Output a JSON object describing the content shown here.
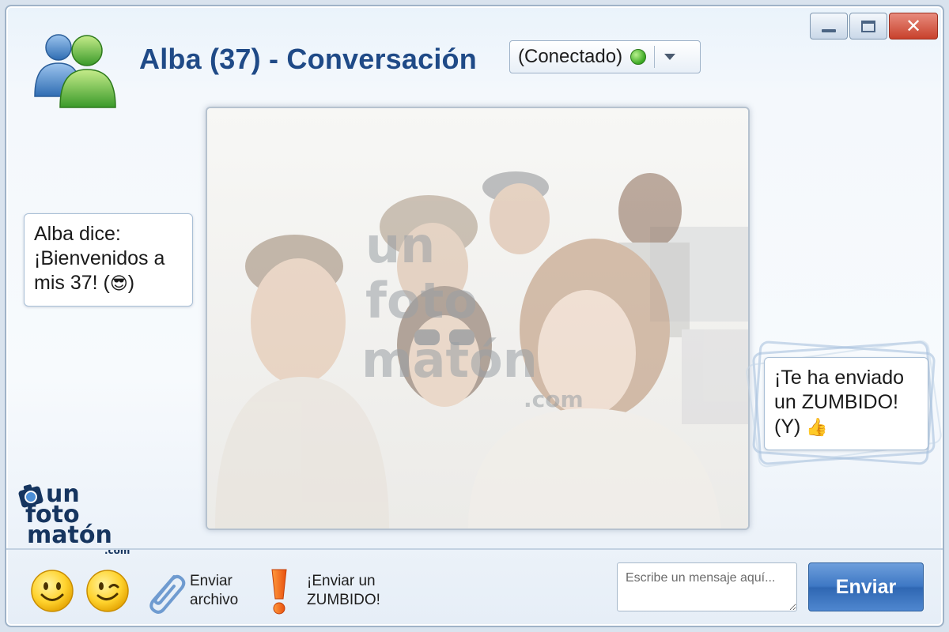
{
  "window": {
    "title": "Alba (37) - Conversación",
    "controls": {
      "minimize_icon": "minimize-icon",
      "maximize_icon": "maximize-icon",
      "close_icon": "close-icon",
      "close_glyph": "✕"
    }
  },
  "status": {
    "label": "(Conectado)",
    "color": "#3aa822"
  },
  "photo": {
    "watermark_lines": [
      "un",
      "foto",
      "matón",
      ".com"
    ]
  },
  "chat": {
    "left_bubble": {
      "line1": "Alba dice:",
      "line2": "¡Bienvenidos a",
      "line3": "mis 37! (",
      "emoji": "😎",
      "line3_end": ")"
    },
    "right_bubble": {
      "line1": "¡Te ha enviado",
      "line2": "un ZUMBIDO!",
      "line3": "(Y) ",
      "emoji": "👍"
    }
  },
  "brand": {
    "line1": "un",
    "line2": "foto",
    "line3": "matón",
    "line4": ".com"
  },
  "toolbar": {
    "smile_icon": "smile-emoji-icon",
    "wink_icon": "wink-emoji-icon",
    "send_file": {
      "line1": "Enviar",
      "line2": "archivo"
    },
    "buzz": {
      "line1": "¡Enviar un",
      "line2": "ZUMBIDO!"
    },
    "message_placeholder": "Escribe un mensaje aquí...",
    "send_label": "Enviar"
  },
  "colors": {
    "title": "#1f4a87",
    "send_button": "#3e78c4",
    "accent": "#2f67b3"
  }
}
